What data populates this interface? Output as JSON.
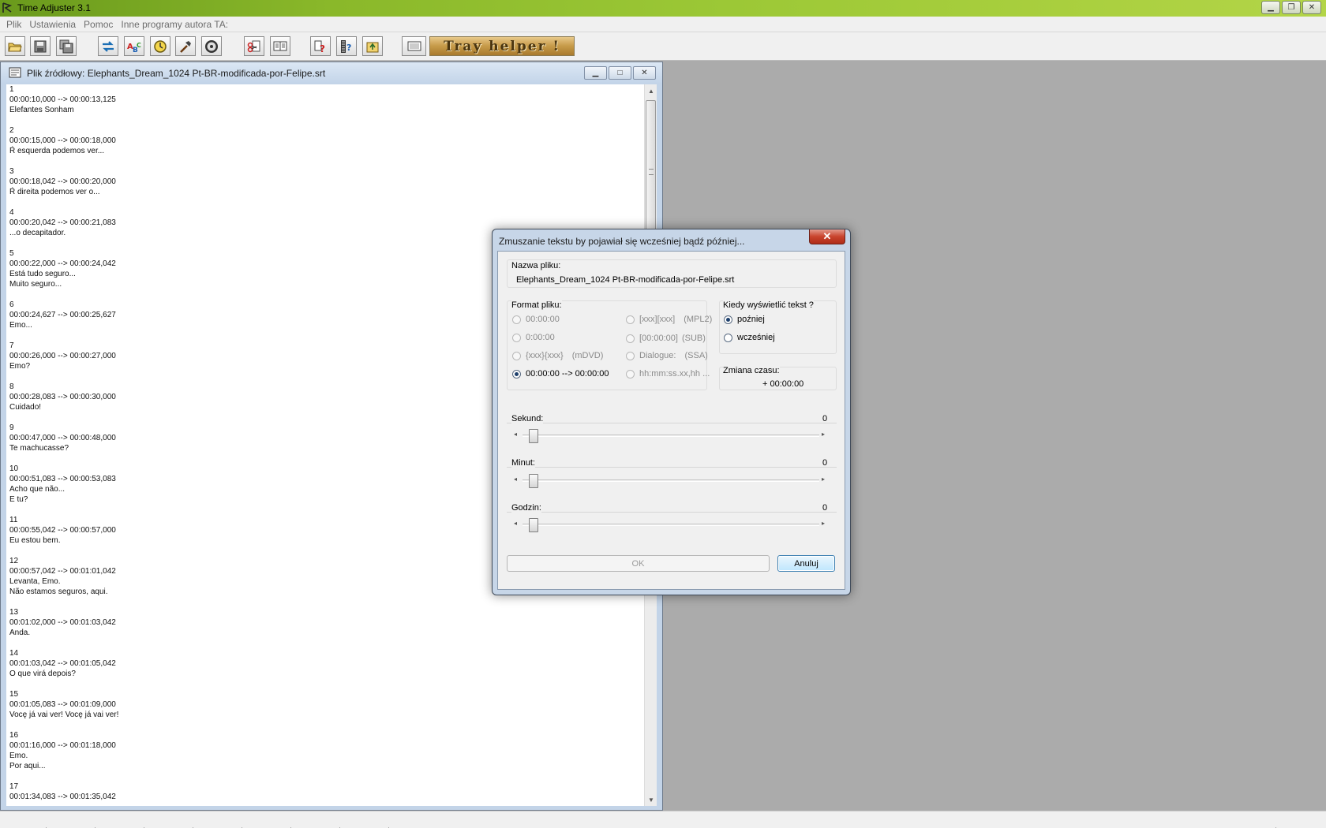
{
  "window": {
    "title": "Time Adjuster 3.1",
    "controls": [
      "minimize",
      "restore",
      "close"
    ]
  },
  "menu": [
    "Plik",
    "Ustawienia",
    "Pomoc",
    "Inne programy autora TA:"
  ],
  "toolbar": {
    "buttons": [
      "open-folder",
      "save",
      "save-all",
      "convert-arrows",
      "text-abc",
      "clock-adjust",
      "hammer-tool",
      "framerate",
      "cut-subtitle",
      "split-merge",
      "help-question",
      "film-help",
      "export"
    ],
    "tray_helper_label": "Tray helper !"
  },
  "child_window": {
    "title": "Plik źródłowy: Elephants_Dream_1024 Pt-BR-modificada-por-Felipe.srt",
    "subtitle_text": "1\n00:00:10,000 --> 00:00:13,125\nElefantes Sonham\n\n2\n00:00:15,000 --> 00:00:18,000\nŔ esquerda podemos ver...\n\n3\n00:00:18,042 --> 00:00:20,000\nŔ direita podemos ver o...\n\n4\n00:00:20,042 --> 00:00:21,083\n...o decapitador.\n\n5\n00:00:22,000 --> 00:00:24,042\nEstá tudo seguro...\nMuito seguro...\n\n6\n00:00:24,627 --> 00:00:25,627\nEmo...\n\n7\n00:00:26,000 --> 00:00:27,000\nEmo?\n\n8\n00:00:28,083 --> 00:00:30,000\nCuidado!\n\n9\n00:00:47,000 --> 00:00:48,000\nTe machucasse?\n\n10\n00:00:51,083 --> 00:00:53,083\nAcho que não...\nE tu?\n\n11\n00:00:55,042 --> 00:00:57,000\nEu estou bem.\n\n12\n00:00:57,042 --> 00:01:01,042\nLevanta, Emo.\nNão estamos seguros, aqui.\n\n13\n00:01:02,000 --> 00:01:03,042\nAnda.\n\n14\n00:01:03,042 --> 00:01:05,042\nO que virá depois?\n\n15\n00:01:05,083 --> 00:01:09,000\nVocę já vai ver! Vocę já vai ver!\n\n16\n00:01:16,000 --> 00:01:18,000\nEmo.\nPor aqui...\n\n17\n00:01:34,083 --> 00:01:35,042"
  },
  "dialog": {
    "title": "Zmuszanie tekstu by pojawiał się wcześniej bądź później...",
    "close_label": "✕",
    "filename_label": "Nazwa pliku:",
    "filename": "Elephants_Dream_1024 Pt-BR-modificada-por-Felipe.srt",
    "format_label": "Format pliku:",
    "formats": [
      {
        "label": "00:00:00",
        "tag": "",
        "checked": false,
        "enabled": false
      },
      {
        "label": "0:00:00",
        "tag": "",
        "checked": false,
        "enabled": false
      },
      {
        "label": "{xxx}{xxx}",
        "tag": "(mDVD)",
        "checked": false,
        "enabled": false
      },
      {
        "label": "00:00:00 --> 00:00:00",
        "tag": "",
        "checked": true,
        "enabled": true
      },
      {
        "label": "[xxx][xxx]",
        "tag": "(MPL2)",
        "checked": false,
        "enabled": false
      },
      {
        "label": "[00:00:00]",
        "tag": "(SUB)",
        "checked": false,
        "enabled": false
      },
      {
        "label": "Dialogue:",
        "tag": "(SSA)",
        "checked": false,
        "enabled": false
      },
      {
        "label": "hh:mm:ss.xx,hh ...",
        "tag": "",
        "checked": false,
        "enabled": false
      }
    ],
    "when_label": "Kiedy wyświetlić tekst ?",
    "when_options": [
      {
        "label": "poźniej",
        "checked": true
      },
      {
        "label": "wcześniej",
        "checked": false
      }
    ],
    "time_change_label": "Zmiana czasu:",
    "time_change_value": "+ 00:00:00",
    "seconds_label": "Sekund:",
    "seconds_value": "0",
    "minutes_label": "Minut:",
    "minutes_value": "0",
    "hours_label": "Godzin:",
    "hours_value": "0",
    "ok_label": "OK",
    "cancel_label": "Anuluj"
  }
}
